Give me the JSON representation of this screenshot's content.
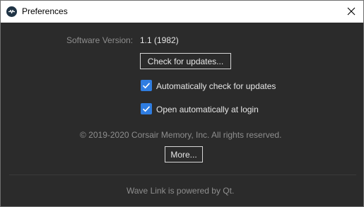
{
  "window": {
    "title": "Preferences",
    "app_icon": "wave-link-icon",
    "close_icon": "close-icon"
  },
  "version": {
    "label": "Software Version:",
    "value": "1.1 (1982)"
  },
  "buttons": {
    "check_updates": "Check for updates...",
    "more": "More..."
  },
  "options": {
    "auto_check": {
      "label": "Automatically check for updates",
      "checked": true
    },
    "open_login": {
      "label": "Open automatically at login",
      "checked": true
    }
  },
  "copyright": "© 2019-2020 Corsair Memory, Inc. All rights reserved.",
  "footer": "Wave Link is powered by Qt.",
  "colors": {
    "background": "#2b2b2b",
    "checkbox_accent": "#2f7de1",
    "titlebar": "#ffffff"
  }
}
